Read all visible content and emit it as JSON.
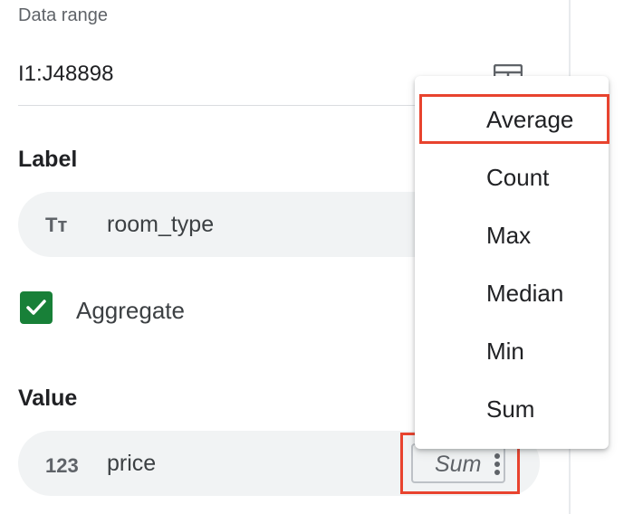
{
  "data_range": {
    "label": "Data range",
    "value": "I1:J48898",
    "icon": "grid-select-icon"
  },
  "label_section": {
    "title": "Label",
    "field": {
      "icon_text": "Tт",
      "icon": "text-type-icon",
      "name": "room_type"
    },
    "aggregate": {
      "checked": true,
      "label": "Aggregate"
    }
  },
  "value_section": {
    "title": "Value",
    "field": {
      "icon_text": "123",
      "icon": "number-type-icon",
      "name": "price",
      "aggregation": "Sum"
    }
  },
  "aggregation_menu": {
    "items": [
      "Average",
      "Count",
      "Max",
      "Median",
      "Min",
      "Sum"
    ],
    "highlighted": "Average"
  },
  "colors": {
    "accent_green": "#188038",
    "highlight_red": "#e8432e",
    "chip_bg": "#f1f3f4"
  }
}
